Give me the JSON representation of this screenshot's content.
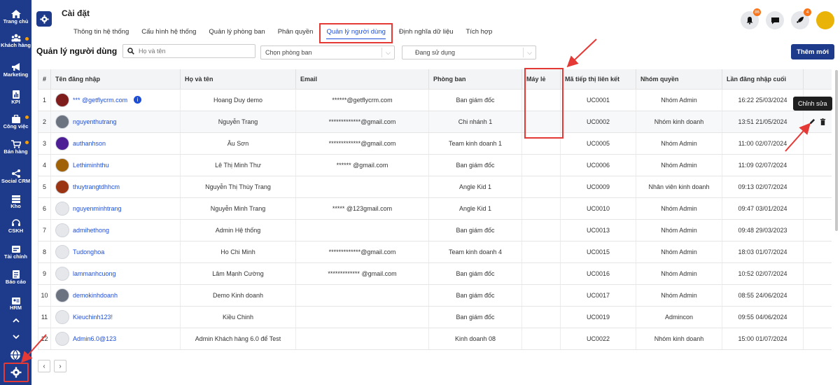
{
  "sidebar": {
    "items": [
      {
        "label": "Trang chủ",
        "icon": "home-icon"
      },
      {
        "label": "Khách hàng",
        "icon": "customers-icon"
      },
      {
        "label": "Marketing",
        "icon": "megaphone-icon"
      },
      {
        "label": "KPI",
        "icon": "kpi-icon"
      },
      {
        "label": "Công việc",
        "icon": "task-icon"
      },
      {
        "label": "Bán hàng",
        "icon": "cart-icon"
      },
      {
        "label": "Social CRM",
        "icon": "share-icon"
      },
      {
        "label": "Kho",
        "icon": "warehouse-icon"
      },
      {
        "label": "CSKH",
        "icon": "support-icon"
      },
      {
        "label": "Tài chính",
        "icon": "finance-icon"
      },
      {
        "label": "Báo cáo",
        "icon": "report-icon"
      },
      {
        "label": "HRM",
        "icon": "hrm-icon"
      }
    ]
  },
  "header": {
    "title": "Cài đặt",
    "tabs": [
      {
        "label": "Thông tin hệ thống"
      },
      {
        "label": "Cấu hình hệ thống"
      },
      {
        "label": "Quản lý phòng ban"
      },
      {
        "label": "Phân quyền"
      },
      {
        "label": "Quản lý người dùng",
        "active": true
      },
      {
        "label": "Định nghĩa dữ liệu"
      },
      {
        "label": "Tích hợp"
      }
    ],
    "notification_badge": "86",
    "rocket_badge": "4"
  },
  "toolbar": {
    "section_title": "Quản lý người dùng",
    "search_placeholder": "Họ và tên",
    "department_select": "Chọn phòng ban",
    "status_select": "Đang sử dụng",
    "add_button": "Thêm mới"
  },
  "table": {
    "columns": [
      "#",
      "Tên đăng nhập",
      "Họ và tên",
      "Email",
      "Phòng ban",
      "Máy lẻ",
      "Mã tiếp thị liên kết",
      "Nhóm quyền",
      "Lần đăng nhập cuối",
      ""
    ],
    "rows": [
      {
        "no": "1",
        "username": "*** @getflycrm.com",
        "fullname": "Hoang Duy demo",
        "email": "******@getflycrm.com",
        "dept": "Ban giám đốc",
        "ext": "",
        "code": "UC0001",
        "group": "Nhóm Admin",
        "last_login": "16:22 25/03/2024"
      },
      {
        "no": "2",
        "username": "nguyenthutrang",
        "fullname": "Nguyễn Trang",
        "email": "*************@gmail.com",
        "dept": "Chi nhánh 1",
        "ext": "",
        "code": "UC0002",
        "group": "Nhóm kinh doanh",
        "last_login": "13:51 21/05/2024"
      },
      {
        "no": "3",
        "username": "authanhson",
        "fullname": "Âu Sơn",
        "email": "*************@gmail.com",
        "dept": "Team kinh doanh 1",
        "ext": "",
        "code": "UC0005",
        "group": "Nhóm Admin",
        "last_login": "11:00 02/07/2024"
      },
      {
        "no": "4",
        "username": "Lethiminhthu",
        "fullname": "Lê Thị Minh Thư",
        "email": "****** @gmail.com",
        "dept": "Ban giám đốc",
        "ext": "",
        "code": "UC0006",
        "group": "Nhóm Admin",
        "last_login": "11:09 02/07/2024"
      },
      {
        "no": "5",
        "username": "thuytrangtdhhcm",
        "fullname": "Nguyễn Thị Thùy Trang",
        "email": "",
        "dept": "Angle Kid 1",
        "ext": "",
        "code": "UC0009",
        "group": "Nhân viên kinh doanh",
        "last_login": "09:13 02/07/2024"
      },
      {
        "no": "6",
        "username": "nguyenminhtrang",
        "fullname": "Nguyễn Minh Trang",
        "email": "***** @123gmail.com",
        "dept": "Angle Kid 1",
        "ext": "",
        "code": "UC0010",
        "group": "Nhóm Admin",
        "last_login": "09:47 03/01/2024"
      },
      {
        "no": "7",
        "username": "admihethong",
        "fullname": "Admin Hệ thống",
        "email": "",
        "dept": "Ban giám đốc",
        "ext": "",
        "code": "UC0013",
        "group": "Nhóm Admin",
        "last_login": "09:48 29/03/2023"
      },
      {
        "no": "8",
        "username": "Tudonghoa",
        "fullname": "Ho Chi Minh",
        "email": "*************@gmail.com",
        "dept": "Team kinh doanh 4",
        "ext": "",
        "code": "UC0015",
        "group": "Nhóm Admin",
        "last_login": "18:03 01/07/2024"
      },
      {
        "no": "9",
        "username": "lammanhcuong",
        "fullname": "Lâm Mạnh Cường",
        "email": "************* @gmail.com",
        "dept": "Ban giám đốc",
        "ext": "",
        "code": "UC0016",
        "group": "Nhóm Admin",
        "last_login": "10:52 02/07/2024"
      },
      {
        "no": "10",
        "username": "demokinhdoanh",
        "fullname": "Demo Kinh doanh",
        "email": "",
        "dept": "Ban giám đốc",
        "ext": "",
        "code": "UC0017",
        "group": "Nhóm Admin",
        "last_login": "08:55 24/06/2024"
      },
      {
        "no": "11",
        "username": "Kieuchinh123!",
        "fullname": "Kiều Chinh",
        "email": "",
        "dept": "Ban giám đốc",
        "ext": "",
        "code": "UC0019",
        "group": "Admincon",
        "last_login": "09:55 04/06/2024"
      },
      {
        "no": "12",
        "username": "Admin6.0@123",
        "fullname": "Admin Khách hàng 6.0 để Test",
        "email": "",
        "dept": "Kinh doanh 08",
        "ext": "",
        "code": "UC0022",
        "group": "Nhóm kinh doanh",
        "last_login": "15:00 01/07/2024"
      }
    ]
  },
  "tooltip": "Chỉnh sửa",
  "colors": {
    "sidebar": "#1e3a8a",
    "accent": "#1d4ed8",
    "highlight": "#e53935"
  }
}
